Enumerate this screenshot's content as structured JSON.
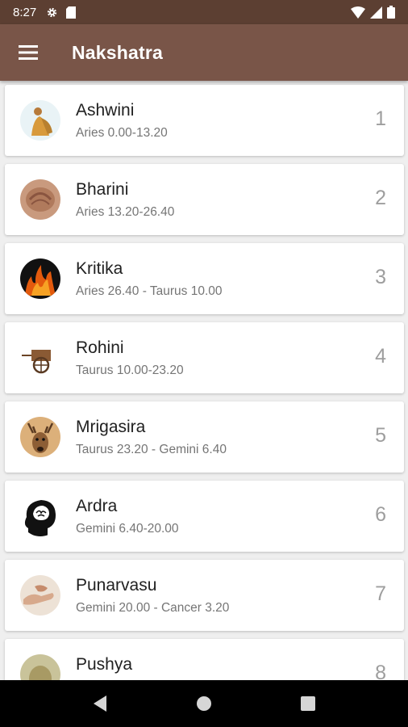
{
  "status_bar": {
    "time": "8:27",
    "icons": [
      "gear-icon",
      "sd-card-icon",
      "wifi-icon",
      "signal-icon",
      "battery-icon"
    ]
  },
  "app_bar": {
    "title": "Nakshatra",
    "menu_icon": "menu-icon"
  },
  "nakshatras": [
    {
      "name": "Ashwini",
      "range": "Aries 0.00-13.20",
      "number": "1"
    },
    {
      "name": "Bharini",
      "range": "Aries 13.20-26.40",
      "number": "2"
    },
    {
      "name": "Kritika",
      "range": "Aries 26.40 - Taurus 10.00",
      "number": "3"
    },
    {
      "name": "Rohini",
      "range": "Taurus 10.00-23.20",
      "number": "4"
    },
    {
      "name": "Mrigasira",
      "range": "Taurus 23.20 - Gemini 6.40",
      "number": "5"
    },
    {
      "name": "Ardra",
      "range": "Gemini 6.40-20.00",
      "number": "6"
    },
    {
      "name": "Punarvasu",
      "range": "Gemini 20.00 - Cancer 3.20",
      "number": "7"
    },
    {
      "name": "Pushya",
      "range": "",
      "number": "8"
    }
  ],
  "nav_bar": {
    "icons": [
      "back-icon",
      "home-icon",
      "recents-icon"
    ]
  }
}
